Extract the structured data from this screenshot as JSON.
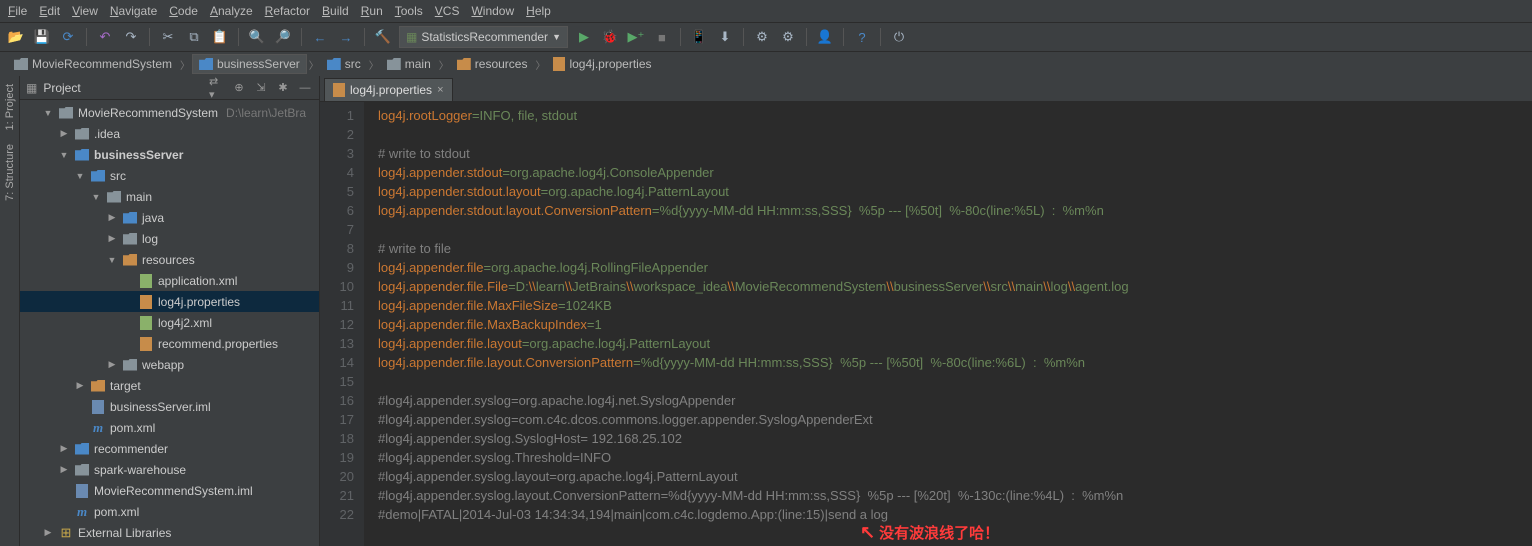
{
  "menu": [
    "File",
    "Edit",
    "View",
    "Navigate",
    "Code",
    "Analyze",
    "Refactor",
    "Build",
    "Run",
    "Tools",
    "VCS",
    "Window",
    "Help"
  ],
  "run_config": "StatisticsRecommender",
  "breadcrumb": [
    {
      "label": "MovieRecommendSystem",
      "type": "folder"
    },
    {
      "label": "businessServer",
      "type": "folder-blue",
      "sel": true
    },
    {
      "label": "src",
      "type": "folder-blue"
    },
    {
      "label": "main",
      "type": "folder"
    },
    {
      "label": "resources",
      "type": "folder-orange"
    },
    {
      "label": "log4j.properties",
      "type": "file-prop"
    }
  ],
  "side_tabs": [
    "1: Project",
    "7: Structure"
  ],
  "panel": {
    "title": "Project"
  },
  "tree": [
    {
      "d": 0,
      "arr": "▼",
      "ic": "folder",
      "label": "MovieRecommendSystem",
      "hint": "D:\\learn\\JetBra"
    },
    {
      "d": 1,
      "arr": "▶",
      "ic": "folder",
      "label": ".idea"
    },
    {
      "d": 1,
      "arr": "▼",
      "ic": "folder-blue",
      "label": "businessServer",
      "bold": true
    },
    {
      "d": 2,
      "arr": "▼",
      "ic": "folder-blue",
      "label": "src"
    },
    {
      "d": 3,
      "arr": "▼",
      "ic": "folder",
      "label": "main"
    },
    {
      "d": 4,
      "arr": "▶",
      "ic": "folder-blue",
      "label": "java"
    },
    {
      "d": 4,
      "arr": "▶",
      "ic": "folder",
      "label": "log"
    },
    {
      "d": 4,
      "arr": "▼",
      "ic": "folder-orange",
      "label": "resources"
    },
    {
      "d": 5,
      "arr": "",
      "ic": "file-xml",
      "label": "application.xml"
    },
    {
      "d": 5,
      "arr": "",
      "ic": "file-prop",
      "label": "log4j.properties",
      "sel": true
    },
    {
      "d": 5,
      "arr": "",
      "ic": "file-xml",
      "label": "log4j2.xml"
    },
    {
      "d": 5,
      "arr": "",
      "ic": "file-prop",
      "label": "recommend.properties"
    },
    {
      "d": 4,
      "arr": "▶",
      "ic": "folder",
      "label": "webapp"
    },
    {
      "d": 2,
      "arr": "▶",
      "ic": "folder-orange",
      "label": "target"
    },
    {
      "d": 2,
      "arr": "",
      "ic": "file-iml",
      "label": "businessServer.iml"
    },
    {
      "d": 2,
      "arr": "",
      "ic": "file-m",
      "label": "pom.xml"
    },
    {
      "d": 1,
      "arr": "▶",
      "ic": "folder-blue",
      "label": "recommender"
    },
    {
      "d": 1,
      "arr": "▶",
      "ic": "folder",
      "label": "spark-warehouse"
    },
    {
      "d": 1,
      "arr": "",
      "ic": "file-iml",
      "label": "MovieRecommendSystem.iml"
    },
    {
      "d": 1,
      "arr": "",
      "ic": "file-m",
      "label": "pom.xml"
    },
    {
      "d": 0,
      "arr": "▶",
      "ic": "lib",
      "label": "External Libraries"
    }
  ],
  "editor_tab": "log4j.properties",
  "code_lines": [
    {
      "n": 1,
      "seg": [
        [
          "k",
          "log4j.rootLogger"
        ],
        [
          "v",
          "=INFO, file, stdout"
        ]
      ]
    },
    {
      "n": 2,
      "seg": []
    },
    {
      "n": 3,
      "seg": [
        [
          "c",
          "# write to stdout"
        ]
      ]
    },
    {
      "n": 4,
      "seg": [
        [
          "k",
          "log4j.appender.stdout"
        ],
        [
          "v",
          "=org.apache.log4j.ConsoleAppender"
        ]
      ]
    },
    {
      "n": 5,
      "seg": [
        [
          "k",
          "log4j.appender.stdout.layout"
        ],
        [
          "v",
          "=org.apache.log4j.PatternLayout"
        ]
      ]
    },
    {
      "n": 6,
      "seg": [
        [
          "k",
          "log4j.appender.stdout.layout.ConversionPattern"
        ],
        [
          "v",
          "=%d{yyyy-MM-dd HH:mm:ss,SSS}  %5p --- [%50t]  %-80c(line:%5L)  :  %m%n"
        ]
      ]
    },
    {
      "n": 7,
      "seg": []
    },
    {
      "n": 8,
      "seg": [
        [
          "c",
          "# write to file"
        ]
      ]
    },
    {
      "n": 9,
      "seg": [
        [
          "k",
          "log4j.appender.file"
        ],
        [
          "v",
          "=org.apache.log4j.RollingFileAppender"
        ]
      ]
    },
    {
      "n": 10,
      "seg": [
        [
          "k",
          "log4j.appender.file.File"
        ],
        [
          "v",
          "=D:"
        ],
        [
          "esc",
          "\\\\"
        ],
        [
          "v",
          "learn"
        ],
        [
          "esc",
          "\\\\"
        ],
        [
          "v",
          "JetBrains"
        ],
        [
          "esc",
          "\\\\"
        ],
        [
          "v",
          "workspace_idea"
        ],
        [
          "esc",
          "\\\\"
        ],
        [
          "v",
          "MovieRecommendSystem"
        ],
        [
          "esc",
          "\\\\"
        ],
        [
          "v",
          "businessServer"
        ],
        [
          "esc",
          "\\\\"
        ],
        [
          "v",
          "src"
        ],
        [
          "esc",
          "\\\\"
        ],
        [
          "v",
          "main"
        ],
        [
          "esc",
          "\\\\"
        ],
        [
          "v",
          "log"
        ],
        [
          "esc",
          "\\\\"
        ],
        [
          "v",
          "agent.log"
        ]
      ]
    },
    {
      "n": 11,
      "seg": [
        [
          "k",
          "log4j.appender.file.MaxFileSize"
        ],
        [
          "v",
          "=1024KB"
        ]
      ]
    },
    {
      "n": 12,
      "seg": [
        [
          "k",
          "log4j.appender.file.MaxBackupIndex"
        ],
        [
          "v",
          "=1"
        ]
      ]
    },
    {
      "n": 13,
      "seg": [
        [
          "k",
          "log4j.appender.file.layout"
        ],
        [
          "v",
          "=org.apache.log4j.PatternLayout"
        ]
      ]
    },
    {
      "n": 14,
      "seg": [
        [
          "k",
          "log4j.appender.file.layout.ConversionPattern"
        ],
        [
          "v",
          "=%d{yyyy-MM-dd HH:mm:ss,SSS}  %5p --- [%50t]  %-80c(line:%6L)  :  %m%n"
        ]
      ]
    },
    {
      "n": 15,
      "seg": []
    },
    {
      "n": 16,
      "seg": [
        [
          "c",
          "#log4j.appender.syslog=org.apache.log4j.net.SyslogAppender"
        ]
      ]
    },
    {
      "n": 17,
      "seg": [
        [
          "c",
          "#log4j.appender.syslog=com.c4c.dcos.commons.logger.appender.SyslogAppenderExt"
        ]
      ]
    },
    {
      "n": 18,
      "seg": [
        [
          "c",
          "#log4j.appender.syslog.SyslogHost= 192.168.25.102"
        ]
      ]
    },
    {
      "n": 19,
      "seg": [
        [
          "c",
          "#log4j.appender.syslog.Threshold=INFO"
        ]
      ]
    },
    {
      "n": 20,
      "seg": [
        [
          "c",
          "#log4j.appender.syslog.layout=org.apache.log4j.PatternLayout"
        ]
      ]
    },
    {
      "n": 21,
      "seg": [
        [
          "c",
          "#log4j.appender.syslog.layout.ConversionPattern=%d{yyyy-MM-dd HH:mm:ss,SSS}  %5p --- [%20t]  %-130c:(line:%4L)  :  %m%n"
        ]
      ]
    },
    {
      "n": 22,
      "seg": [
        [
          "c",
          "#demo|FATAL|2014-Jul-03 14:34:34,194|main|com.c4c.logdemo.App:(line:15)|send a log"
        ]
      ]
    }
  ],
  "annotation": "没有波浪线了哈！"
}
